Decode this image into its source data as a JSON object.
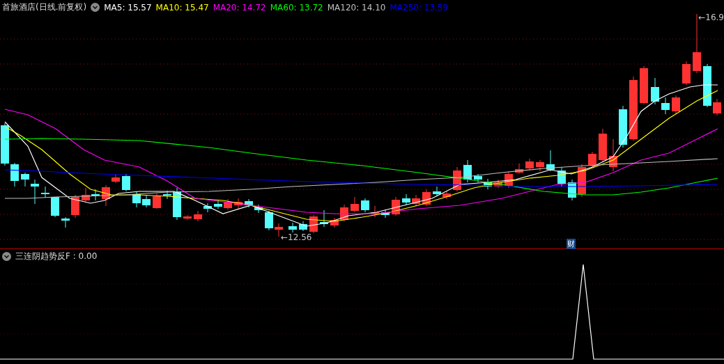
{
  "price_panel": {
    "title": "首旅酒店(日线.前复权)",
    "moving_averages": [
      {
        "label": "MA5: 15.57",
        "color": "#ffffff"
      },
      {
        "label": "MA10: 15.47",
        "color": "#ffff00"
      },
      {
        "label": "MA20: 14.72",
        "color": "#ff00ff"
      },
      {
        "label": "MA60: 13.72",
        "color": "#00ff00"
      },
      {
        "label": "MA120: 14.10",
        "color": "#c0c0c0"
      },
      {
        "label": "MA250: 13.59",
        "color": "#0000ff"
      }
    ],
    "high_arrow": "←",
    "high_label": "16.9",
    "low_arrow": "←",
    "low_label": "12.56",
    "event_marker": "财"
  },
  "indicator_panel": {
    "title": "三连阴趋势反F : 0.00"
  }
}
